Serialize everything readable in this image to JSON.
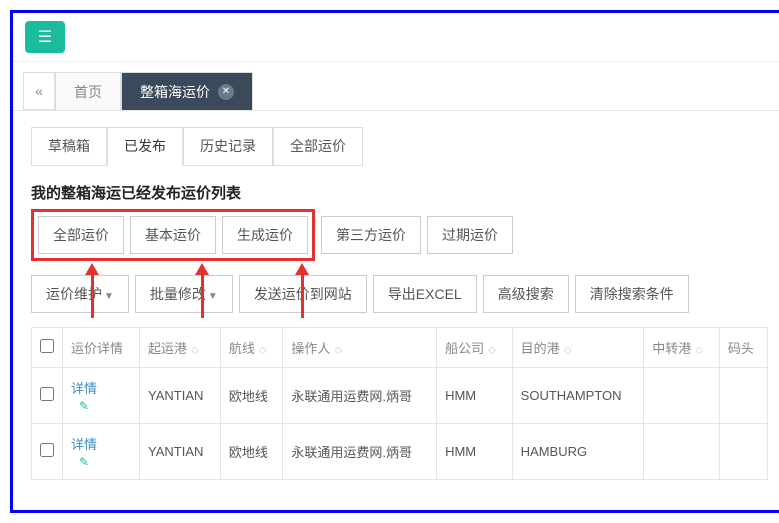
{
  "nav": {
    "home": "首页",
    "activeTab": "整箱海运价"
  },
  "subtabs": {
    "draft": "草稿箱",
    "published": "已发布",
    "history": "历史记录",
    "allRates": "全部运价"
  },
  "section": {
    "title": "我的整箱海运已经发布运价列表"
  },
  "filters": {
    "all": "全部运价",
    "basic": "基本运价",
    "generated": "生成运价",
    "thirdParty": "第三方运价",
    "expired": "过期运价"
  },
  "actions": {
    "maintain": "运价维护",
    "batchEdit": "批量修改",
    "sendToSite": "发送运价到网站",
    "exportExcel": "导出EXCEL",
    "advSearch": "高级搜索",
    "clearSearch": "清除搜索条件"
  },
  "columns": {
    "detail": "运价详情",
    "pol": "起运港",
    "lane": "航线",
    "operator": "操作人",
    "carrier": "船公司",
    "pod": "目的港",
    "via": "中转港",
    "terminal": "码头"
  },
  "rows": [
    {
      "detail": "详情",
      "pol": "YANTIAN",
      "lane": "欧地线",
      "operator": "永联通用运费网.炳哥",
      "carrier": "HMM",
      "pod": "SOUTHAMPTON"
    },
    {
      "detail": "详情",
      "pol": "YANTIAN",
      "lane": "欧地线",
      "operator": "永联通用运费网.炳哥",
      "carrier": "HMM",
      "pod": "HAMBURG"
    }
  ]
}
